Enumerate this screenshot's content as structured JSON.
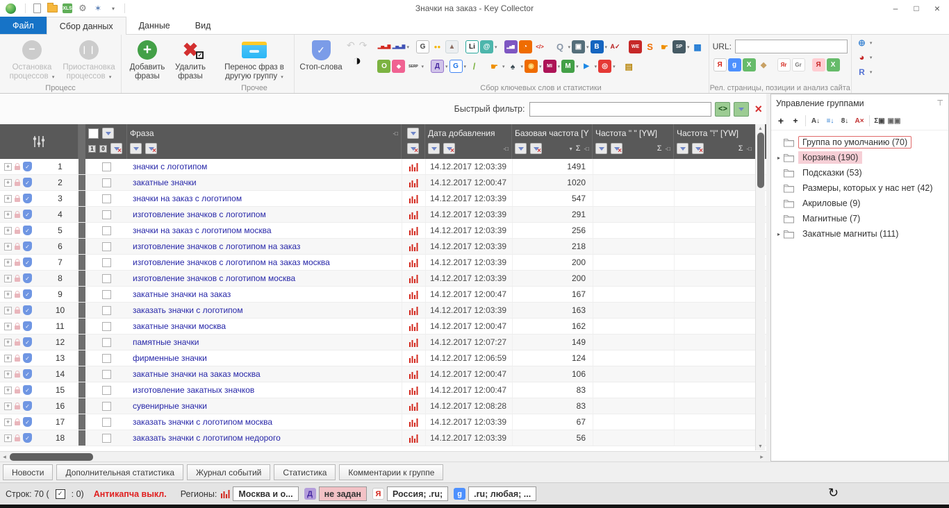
{
  "glyphs": {
    "dropdown": "▾",
    "sigma": "Σ",
    "pin": "-□",
    "sort_desc": "▾",
    "expand": "+",
    "tree_arrow": "▸",
    "scroll_up": "▲",
    "scroll_down": "▼",
    "scroll_left": "◂",
    "scroll_right": "▸",
    "minimize": "–",
    "restore": "□",
    "close": "×",
    "undo": "↶",
    "redo": "↷",
    "refresh": "↻",
    "check": "✓",
    "contrast": "◑",
    "one": "1",
    "zero": "0"
  },
  "window": {
    "title": "Значки на заказ - Key Collector"
  },
  "quick_access": [
    {
      "name": "new-project-icon",
      "type": "doc"
    },
    {
      "name": "open-project-icon",
      "type": "folder"
    },
    {
      "name": "export-xls-icon",
      "type": "xls",
      "glyph": "XLS"
    },
    {
      "name": "settings-gear-icon",
      "glyph": "⚙",
      "fg": "#808080",
      "fs": 13
    },
    {
      "name": "wizard-icon",
      "glyph": "✶",
      "fg": "#5a7fb5",
      "fs": 12
    },
    {
      "name": "toolbar-options-icon",
      "glyph": "▾",
      "fg": "#777",
      "fs": 8
    }
  ],
  "tabs": [
    {
      "label": "Файл",
      "type": "file"
    },
    {
      "label": "Сбор данных",
      "type": "active"
    },
    {
      "label": "Данные",
      "type": "plain"
    },
    {
      "label": "Вид",
      "type": "plain"
    }
  ],
  "ribbon": {
    "process": {
      "label": "Процесс",
      "stop": "Остановка процессов",
      "pause": "Приостановка процессов"
    },
    "add_label": "Добавить фразы",
    "delete_label": "Удалить фразы",
    "misc": {
      "label": "Прочее",
      "transfer": "Перенос фраз в другую группу"
    },
    "stopwords_label": "Стоп-слова",
    "collection": {
      "label": "Сбор ключевых слов и статистики",
      "row1": [
        {
          "name": "wordstat-red-bars-icon",
          "glyph": "▂▅▃▇",
          "flat": true,
          "fg": "#d3281e",
          "fs": 6
        },
        {
          "name": "wordstat-blue-bars-icon",
          "glyph": "▂▅▃▇",
          "flat": true,
          "fg": "#3f51b5",
          "fs": 6,
          "drop": true
        },
        {
          "name": "google-analytics-icon",
          "glyph": "G",
          "bg": "#ffffff",
          "fg": "#444444",
          "border": "#bbbbbb",
          "gap": true
        },
        {
          "name": "adwords-dots-icon",
          "glyph": "●●",
          "flat": true,
          "fg": "#f4b400",
          "fs": 8
        },
        {
          "name": "picture-stats-icon",
          "glyph": "▲",
          "bg": "#eceff1",
          "fg": "#8d6e63",
          "border": "#cfd8dc"
        },
        {
          "name": "liveinternet-icon",
          "glyph": "Li",
          "bg": "#ffffff",
          "fg": "#222222",
          "border": "#26a69a",
          "gap": true
        },
        {
          "name": "mail-metrika-icon",
          "glyph": "@",
          "bg": "#4db6ac",
          "fg": "#ffffff",
          "drop": true
        },
        {
          "name": "purple-chart-icon",
          "glyph": "▂▅▇",
          "bg": "#7e57c2",
          "fg": "#ffffff",
          "fs": 5,
          "gap": true
        },
        {
          "name": "analytics-orange-icon",
          "glyph": "◔",
          "bg": "#ef6c00",
          "fg": "#ffffff"
        },
        {
          "name": "code-metrics-icon",
          "glyph": "</>",
          "flat": true,
          "fg": "#d3281e",
          "fs": 8
        },
        {
          "name": "search-icon",
          "glyph": "Q",
          "flat": true,
          "fg": "#8a97a8",
          "fs": 13,
          "drop": true,
          "gap": true
        },
        {
          "name": "screenshot-icon",
          "glyph": "▣",
          "bg": "#546e7a",
          "fg": "#ffffff",
          "drop": true
        },
        {
          "name": "bing-icon",
          "glyph": "B",
          "bg": "#1565c0",
          "fg": "#ffffff",
          "drop": true
        },
        {
          "name": "spellcheck-icon",
          "glyph": "A✓",
          "flat": true,
          "fg": "#b71c1c",
          "fs": 9
        },
        {
          "name": "megaindex-icon",
          "glyph": "WE",
          "bg": "#c62828",
          "fg": "#ffffff",
          "fs": 7,
          "gap": true
        },
        {
          "name": "seopult-icon",
          "glyph": "S",
          "flat": true,
          "fg": "#ef6c00",
          "fs": 13
        },
        {
          "name": "manual-hand-icon",
          "glyph": "☛",
          "flat": true,
          "fg": "#ef8f00",
          "fs": 12
        },
        {
          "name": "sape-icon",
          "glyph": "SP",
          "bg": "#455a64",
          "fg": "#ffffff",
          "fs": 7,
          "drop": true
        },
        {
          "name": "calculator-icon",
          "glyph": "▦",
          "flat": true,
          "fg": "#1976d2",
          "fs": 12
        }
      ],
      "row2": [
        {
          "name": "green-o-icon",
          "glyph": "O",
          "bg": "#7cb342",
          "fg": "#ffffff"
        },
        {
          "name": "maps-icon",
          "glyph": "◆",
          "bg": "#f06292",
          "fg": "#ffffff",
          "fs": 8
        },
        {
          "name": "serp-parser-icon",
          "glyph": "SERP",
          "flat": true,
          "fg": "#333333",
          "fs": 5,
          "drop": true
        },
        {
          "name": "yandex-direct-icon",
          "glyph": "Д",
          "bg": "#d1c4e9",
          "fg": "#4527a0",
          "border": "#9575cd",
          "drop": true,
          "gap": true
        },
        {
          "name": "google-ads-icon",
          "glyph": "G",
          "bg": "#ffffff",
          "fg": "#1a73e8",
          "border": "#4285f4",
          "drop": true
        },
        {
          "name": "leaf-icon",
          "glyph": "/",
          "flat": true,
          "fg": "#7cb342",
          "fs": 13
        },
        {
          "name": "hand-collect-icon",
          "glyph": "☛",
          "flat": true,
          "fg": "#ef8f00",
          "fs": 12,
          "drop": true,
          "gap": true
        },
        {
          "name": "spywords-icon",
          "glyph": "♠",
          "flat": true,
          "fg": "#37474f",
          "fs": 12,
          "drop": true
        },
        {
          "name": "fireball-icon",
          "glyph": "◉",
          "bg": "#ef6c00",
          "fg": "#ffe082",
          "drop": true
        },
        {
          "name": "mutagen-icon",
          "glyph": "MI",
          "bg": "#ad1457",
          "fg": "#ffffff",
          "fs": 7,
          "drop": true
        },
        {
          "name": "majento-icon",
          "glyph": "M",
          "bg": "#43a047",
          "fg": "#ffffff",
          "drop": true
        },
        {
          "name": "justmagic-icon",
          "glyph": "▶",
          "flat": true,
          "fg": "#1e88e5",
          "drop": true
        },
        {
          "name": "target-icon",
          "glyph": "◎",
          "bg": "#e53935",
          "fg": "#ffffff",
          "drop": true
        },
        {
          "name": "archive-icon",
          "glyph": "▤",
          "flat": true,
          "fg": "#b8860b",
          "fs": 12,
          "gap": true
        }
      ]
    },
    "analysis": {
      "label": "Рел. страницы, позиции и анализ сайта",
      "url_label": "URL:",
      "url_value": "",
      "icons": [
        {
          "name": "yandex-check-icon",
          "glyph": "Я",
          "bg": "#ffffff",
          "fg": "#d4281e",
          "border": "#cccccc"
        },
        {
          "name": "google-check-icon",
          "glyph": "g",
          "bg": "#4d90fe",
          "fg": "#ffffff"
        },
        {
          "name": "export-xls-icon",
          "glyph": "X",
          "bg": "#66bb6a",
          "fg": "#ffffff"
        },
        {
          "name": "eraser-icon",
          "glyph": "◆",
          "flat": true,
          "fg": "#c8a165",
          "fs": 11
        },
        {
          "name": "yandex-relevance-icon",
          "glyph": "Яr",
          "bg": "#ffffff",
          "fg": "#d4281e",
          "border": "#dddddd",
          "fs": 8,
          "gap": true
        },
        {
          "name": "google-relevance-icon",
          "glyph": "Gr",
          "bg": "#ffffff",
          "fg": "#777777",
          "border": "#dddddd",
          "fs": 8
        },
        {
          "name": "yandex-update-icon",
          "glyph": "Я",
          "bg": "#ffcdd2",
          "fg": "#c62828",
          "gap": true
        },
        {
          "name": "export-xls-green-icon",
          "glyph": "X",
          "bg": "#66bb6a",
          "fg": "#ffffff"
        }
      ]
    },
    "right_icons": [
      {
        "name": "proxy-globe-icon",
        "glyph": "⊕",
        "flat": true,
        "fg": "#4d8fd6",
        "fs": 13,
        "drop": true
      },
      {
        "name": "statistics-pie-icon",
        "glyph": "◕",
        "flat": true,
        "fg": "#c62828",
        "fs": 13,
        "drop": true
      },
      {
        "name": "reports-icon",
        "glyph": "R",
        "flat": true,
        "fg": "#5472d3",
        "fs": 12,
        "drop": true
      }
    ]
  },
  "filter": {
    "label": "Быстрый фильтр:",
    "value": "",
    "regex_glyph": "<>"
  },
  "table": {
    "columns": {
      "phrase": "Фраза",
      "date": "Дата добавления",
      "base": "Базовая частота [Y",
      "freq_quote": "Частота \" \" [YW]",
      "freq_excl": "Частота \"!\" [YW]"
    },
    "rows": [
      {
        "num": "1",
        "phrase": "значки с логотипом",
        "date": "14.12.2017 12:03:39",
        "base": "1491"
      },
      {
        "num": "2",
        "phrase": "закатные значки",
        "date": "14.12.2017 12:00:47",
        "base": "1020"
      },
      {
        "num": "3",
        "phrase": "значки на заказ с логотипом",
        "date": "14.12.2017 12:03:39",
        "base": "547"
      },
      {
        "num": "4",
        "phrase": "изготовление значков с логотипом",
        "date": "14.12.2017 12:03:39",
        "base": "291"
      },
      {
        "num": "5",
        "phrase": "значки на заказ с логотипом москва",
        "date": "14.12.2017 12:03:39",
        "base": "256"
      },
      {
        "num": "6",
        "phrase": "изготовление значков с логотипом на заказ",
        "date": "14.12.2017 12:03:39",
        "base": "218"
      },
      {
        "num": "7",
        "phrase": "изготовление значков с логотипом на заказ москва",
        "date": "14.12.2017 12:03:39",
        "base": "200"
      },
      {
        "num": "8",
        "phrase": "изготовление значков с логотипом москва",
        "date": "14.12.2017 12:03:39",
        "base": "200"
      },
      {
        "num": "9",
        "phrase": "закатные значки на заказ",
        "date": "14.12.2017 12:00:47",
        "base": "167"
      },
      {
        "num": "10",
        "phrase": "заказать значки с логотипом",
        "date": "14.12.2017 12:03:39",
        "base": "163"
      },
      {
        "num": "11",
        "phrase": "закатные значки москва",
        "date": "14.12.2017 12:00:47",
        "base": "162"
      },
      {
        "num": "12",
        "phrase": "памятные значки",
        "date": "14.12.2017 12:07:27",
        "base": "149"
      },
      {
        "num": "13",
        "phrase": "фирменные значки",
        "date": "14.12.2017 12:06:59",
        "base": "124"
      },
      {
        "num": "14",
        "phrase": "закатные значки на заказ москва",
        "date": "14.12.2017 12:00:47",
        "base": "106"
      },
      {
        "num": "15",
        "phrase": "изготовление закатных значков",
        "date": "14.12.2017 12:00:47",
        "base": "83"
      },
      {
        "num": "16",
        "phrase": "сувенирные значки",
        "date": "14.12.2017 12:08:28",
        "base": "83"
      },
      {
        "num": "17",
        "phrase": "заказать значки с логотипом москва",
        "date": "14.12.2017 12:03:39",
        "base": "67"
      },
      {
        "num": "18",
        "phrase": "заказать значки с логотипом недорого",
        "date": "14.12.2017 12:03:39",
        "base": "56"
      }
    ]
  },
  "groups_panel": {
    "title": "Управление группами",
    "toolbar": [
      {
        "name": "add-group-icon",
        "glyph": "+",
        "fg": "#222",
        "fs": 14
      },
      {
        "name": "add-subgroup-icon",
        "glyph": "+",
        "fg": "#222",
        "fs": 12,
        "sep_after": true
      },
      {
        "name": "sort-az-icon",
        "glyph": "A↓",
        "fg": "#444"
      },
      {
        "name": "sort-color-icon",
        "glyph": "≡↓",
        "fg": "#2e7dd2"
      },
      {
        "name": "sort-numeric-icon",
        "glyph": "8↓",
        "fg": "#444"
      },
      {
        "name": "sort-clear-icon",
        "glyph": "A×",
        "fg": "#c23030",
        "sep_after": true
      },
      {
        "name": "sum-check-icon",
        "glyph": "Σ▣",
        "fg": "#444"
      },
      {
        "name": "group-structure-icon",
        "glyph": "▣▣",
        "fg": "#666"
      }
    ],
    "items": [
      {
        "label": "Группа по умолчанию (70)",
        "state": "selected",
        "expandable": false
      },
      {
        "label": "Корзина (190)",
        "state": "trash",
        "expandable": true
      },
      {
        "label": "Подсказки (53)",
        "state": "normal",
        "expandable": false
      },
      {
        "label": "Размеры, которых у нас нет (42)",
        "state": "normal",
        "expandable": false
      },
      {
        "label": "Акриловые (9)",
        "state": "normal",
        "expandable": false
      },
      {
        "label": "Магнитные (7)",
        "state": "normal",
        "expandable": false
      },
      {
        "label": "Закатные магниты (111)",
        "state": "normal",
        "expandable": true
      }
    ]
  },
  "bottom_tabs": [
    "Новости",
    "Дополнительная статистика",
    "Журнал событий",
    "Статистика",
    "Комментарии к группе"
  ],
  "status": {
    "rows_prefix": "Строк: 70 (",
    "rows_suffix": ": 0)",
    "anticaptcha": "Антикапча выкл.",
    "regions_label": "Регионы:",
    "segments": [
      {
        "icon": "wordstat-bars-icon",
        "type": "bars",
        "label": "Москва и о..."
      },
      {
        "icon": "yandex-direct-icon",
        "glyph": "Д",
        "bg": "#b39ddb",
        "fg": "#4527a0",
        "label": "не задан",
        "alert": true
      },
      {
        "icon": "yandex-icon",
        "glyph": "Я",
        "bg": "#ffffff",
        "fg": "#d4281e",
        "border": "#cccccc",
        "label": "Россия; .ru;"
      },
      {
        "icon": "google-icon",
        "glyph": "g",
        "bg": "#4d90fe",
        "fg": "#ffffff",
        "label": ".ru; любая; ..."
      }
    ]
  }
}
